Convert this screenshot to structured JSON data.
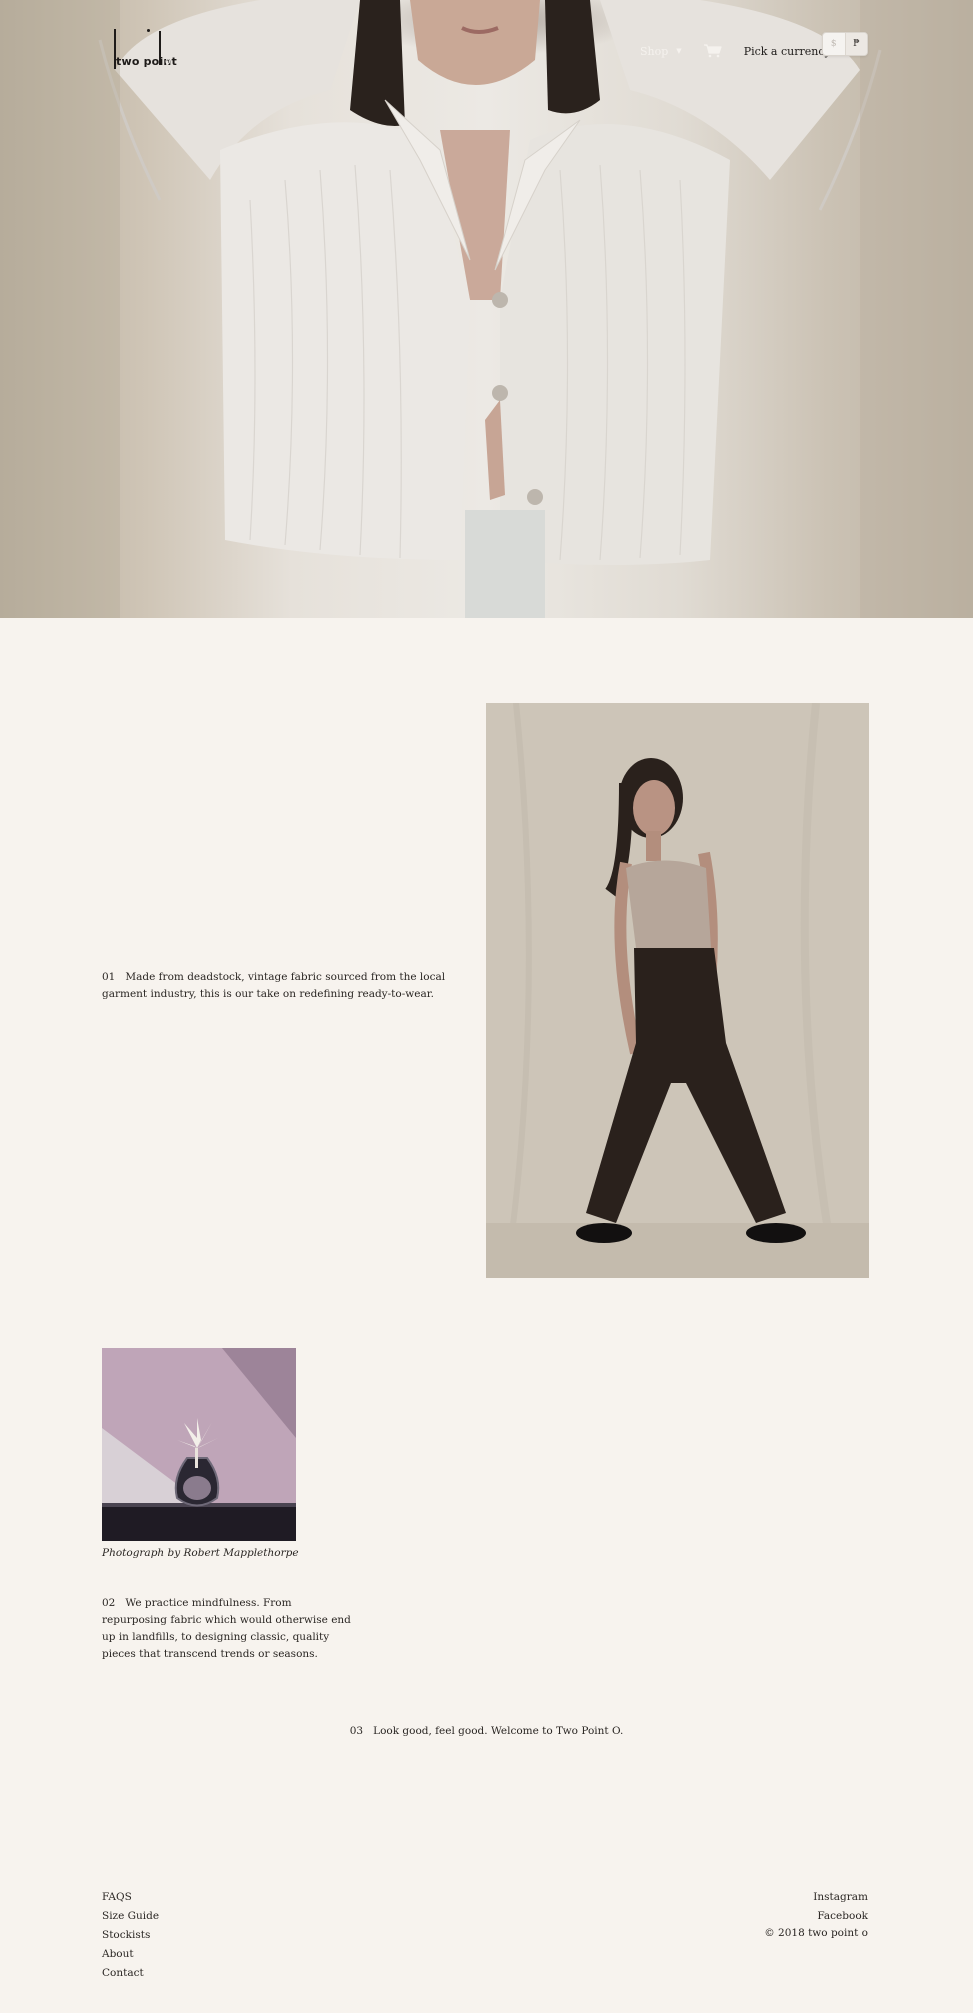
{
  "header": {
    "logo_text": "two point",
    "logo_suffix": "o",
    "nav_shop": "Shop",
    "currency_label": "Pick a currency:",
    "currency_options": [
      "$",
      "₱"
    ],
    "currency_selected": "₱"
  },
  "sections": {
    "s1": {
      "number": "01",
      "text": "Made from deadstock, vintage fabric sourced from the local garment industry, this is our take on redefining ready-to-wear."
    },
    "s2": {
      "caption": "Photograph by Robert Mapplethorpe",
      "number": "02",
      "text": "We practice mindfulness. From repurposing fabric which would otherwise end up in landfills, to designing classic, quality pieces that transcend trends or seasons."
    },
    "s3": {
      "number": "03",
      "text": "Look good, feel good. Welcome to Two Point O."
    }
  },
  "footer": {
    "links": [
      "FAQS",
      "Size Guide",
      "Stockists",
      "About",
      "Contact"
    ],
    "social": [
      "Instagram",
      "Facebook"
    ],
    "copyright": "© 2018 two point o"
  },
  "icons": {
    "cart": "cart-icon",
    "caret": "chevron-down-icon"
  },
  "colors": {
    "background": "#f7f3ee",
    "text": "#2a2623"
  }
}
